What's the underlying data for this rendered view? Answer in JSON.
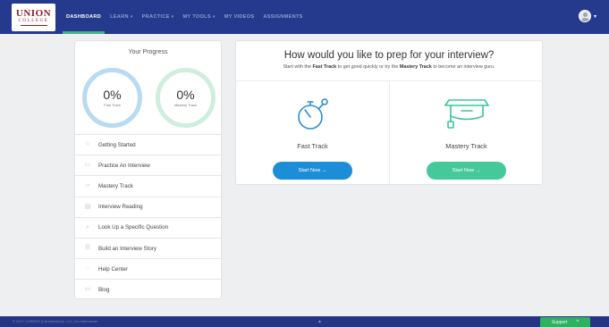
{
  "brand": {
    "logo_main": "UNION",
    "logo_sub": "COLLEGE"
  },
  "nav": {
    "items": [
      {
        "label": "DASHBOARD",
        "caret": ""
      },
      {
        "label": "LEARN",
        "caret": "▾"
      },
      {
        "label": "PRACTICE",
        "caret": "▾"
      },
      {
        "label": "MY TOOLS",
        "caret": "▾"
      },
      {
        "label": "MY VIDEOS",
        "caret": ""
      },
      {
        "label": "ASSIGNMENTS",
        "caret": ""
      }
    ],
    "active_index": 0,
    "user_caret": "▾"
  },
  "progress": {
    "title": "Your Progress",
    "fast_track_pct": "0%",
    "fast_track_label": "Fast Track",
    "mastery_track_pct": "0%",
    "mastery_track_label": "Mastery Track",
    "menu": [
      {
        "label": "Getting Started",
        "icon": "star-icon",
        "glyph": "☆"
      },
      {
        "label": "Practice An Interview",
        "icon": "camera-icon",
        "glyph": "▭"
      },
      {
        "label": "Mastery Track",
        "icon": "cap-icon",
        "glyph": "▱"
      },
      {
        "label": "Interview Reading",
        "icon": "book-icon",
        "glyph": "▤"
      },
      {
        "label": "Look Up a Specific Question",
        "icon": "search-icon",
        "glyph": "⌕"
      },
      {
        "label": "Build an Interview Story",
        "icon": "list-icon",
        "glyph": "☰"
      },
      {
        "label": "Help Center",
        "icon": "help-icon",
        "glyph": "◌"
      },
      {
        "label": "Blog",
        "icon": "blog-icon",
        "glyph": "▭"
      }
    ]
  },
  "prep": {
    "heading": "How would you like to prep for your interview?",
    "sub_pre": "Start with the",
    "sub_fast": "Fast Track",
    "sub_mid": "to get good quickly or try the",
    "sub_mastery": "Mastery Track",
    "sub_post": "to become an interview guru.",
    "fast_track": {
      "name": "Fast Track",
      "button": "Start Now →",
      "icon": "stopwatch-icon"
    },
    "mastery_track": {
      "name": "Mastery Track",
      "button": "Start Now →",
      "icon": "graduation-cap-icon"
    }
  },
  "footer": {
    "copyright": "© 2017 CAREER (Careerlinked), LLC | An Interviewer",
    "dot": "▲",
    "support_label": "Support",
    "support_chevron": "^"
  },
  "colors": {
    "topbar": "#263a8d",
    "nav_active_underline": "#4caf8f",
    "fast_ring": "#b8daf2",
    "mastery_ring": "#cfeedd",
    "fast_button": "#1c8ed8",
    "mastery_button": "#45c99a",
    "icon_stroke": "#2b8fd6",
    "mastery_icon_stroke": "#3ec595",
    "support_button": "#2fb062",
    "footer": "#253583"
  }
}
